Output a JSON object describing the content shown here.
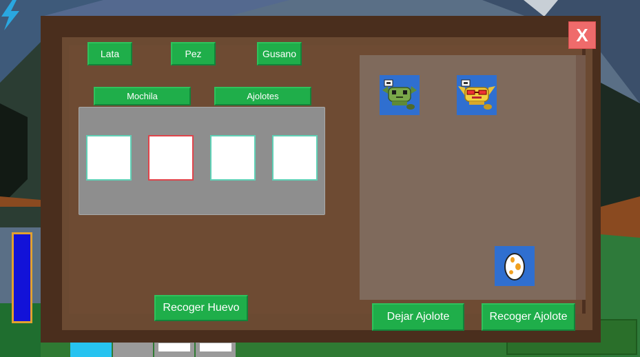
{
  "panel": {
    "close_label": "X"
  },
  "food_buttons": [
    {
      "label": "Lata"
    },
    {
      "label": "Pez"
    },
    {
      "label": "Gusano"
    }
  ],
  "tabs": [
    {
      "label": "Mochila"
    },
    {
      "label": "Ajolotes"
    }
  ],
  "inventory": {
    "slots": 4,
    "selected_slot": 2
  },
  "pen": {
    "axolotls": [
      {
        "icon": "green-axolotl-icon"
      },
      {
        "icon": "yellow-axolotl-sunglasses-icon"
      }
    ],
    "egg": {
      "icon": "egg-icon"
    }
  },
  "actions": {
    "collect_egg": "Recoger Huevo",
    "drop_axolotl": "Dejar Ajolote",
    "collect_axolotl": "Recoger Ajolote"
  },
  "colors": {
    "button_green": "#1fae4a",
    "close_red": "#ef6b6b",
    "panel_brown": "#6b4a32",
    "energy_blue": "#1212d8"
  }
}
